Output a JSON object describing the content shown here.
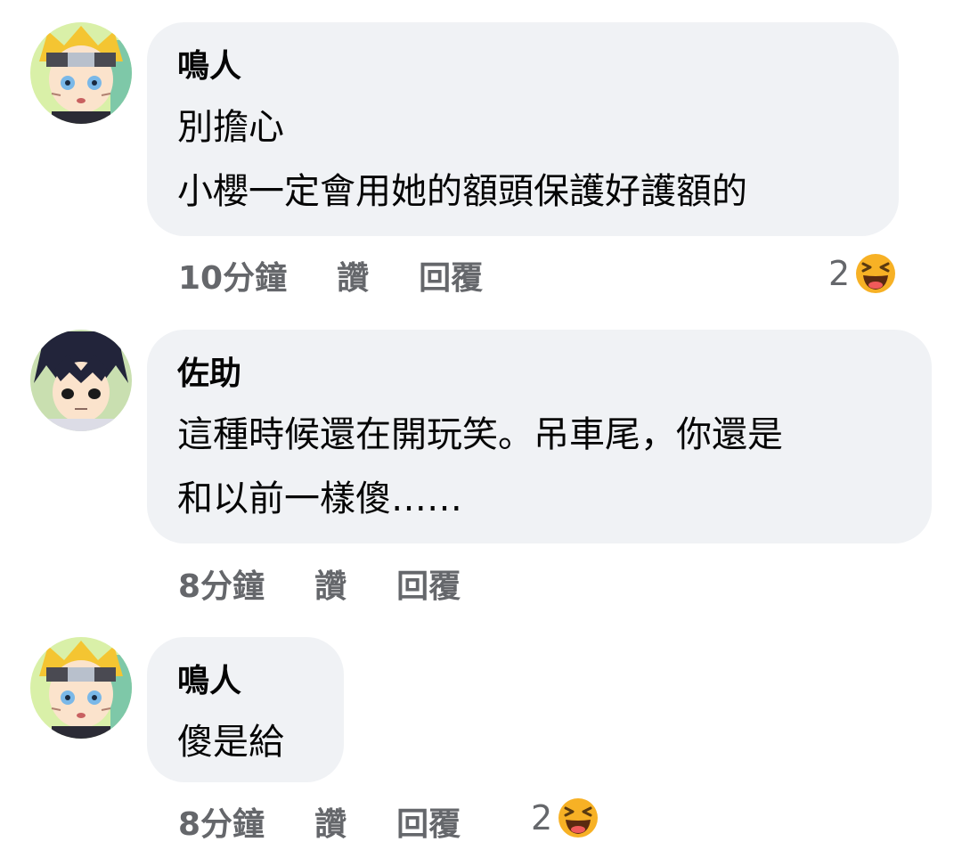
{
  "comments": [
    {
      "author": "鳴人",
      "lines": [
        "別擔心",
        "小櫻一定會用她的額頭保護好護額的"
      ],
      "time": "10分鐘",
      "like_label": "讚",
      "reply_label": "回覆",
      "reaction_count": "2",
      "reaction_icon": "laugh-emoji-icon"
    },
    {
      "author": "佐助",
      "lines": [
        "這種時候還在開玩笑。吊車尾，你還是",
        "和以前一樣傻……"
      ],
      "time": "8分鐘",
      "like_label": "讚",
      "reply_label": "回覆"
    },
    {
      "author": "鳴人",
      "lines": [
        "傻是給"
      ],
      "time": "8分鐘",
      "like_label": "讚",
      "reply_label": "回覆",
      "reaction_count": "2",
      "reaction_icon": "laugh-emoji-icon"
    }
  ],
  "colors": {
    "bubble": "#f0f2f5",
    "meta_text": "#65676b",
    "body_text": "#050505",
    "emoji_yellow": "#f7b125"
  }
}
